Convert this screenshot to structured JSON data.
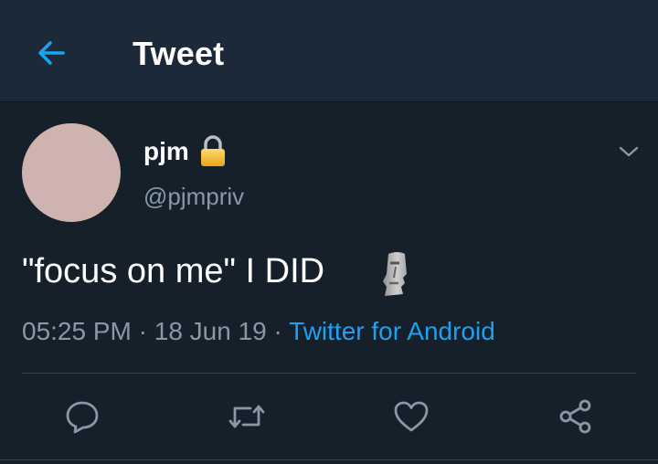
{
  "header": {
    "title": "Tweet",
    "back_icon": "arrow-left-icon"
  },
  "tweet": {
    "author_name": "pjm",
    "author_handle": "@pjmpriv",
    "text": "\"focus on me\" I DID",
    "time": "05:25 PM",
    "date": "18 Jun 19",
    "source": "Twitter for Android",
    "separator": " · "
  },
  "actions": [
    "reply-icon",
    "retweet-icon",
    "like-icon",
    "share-icon"
  ],
  "colors": {
    "background": "#15202b",
    "header": "#1c2938",
    "accent": "#1da1f2",
    "muted": "#8899a6",
    "avatar": "#cfb3b0"
  }
}
